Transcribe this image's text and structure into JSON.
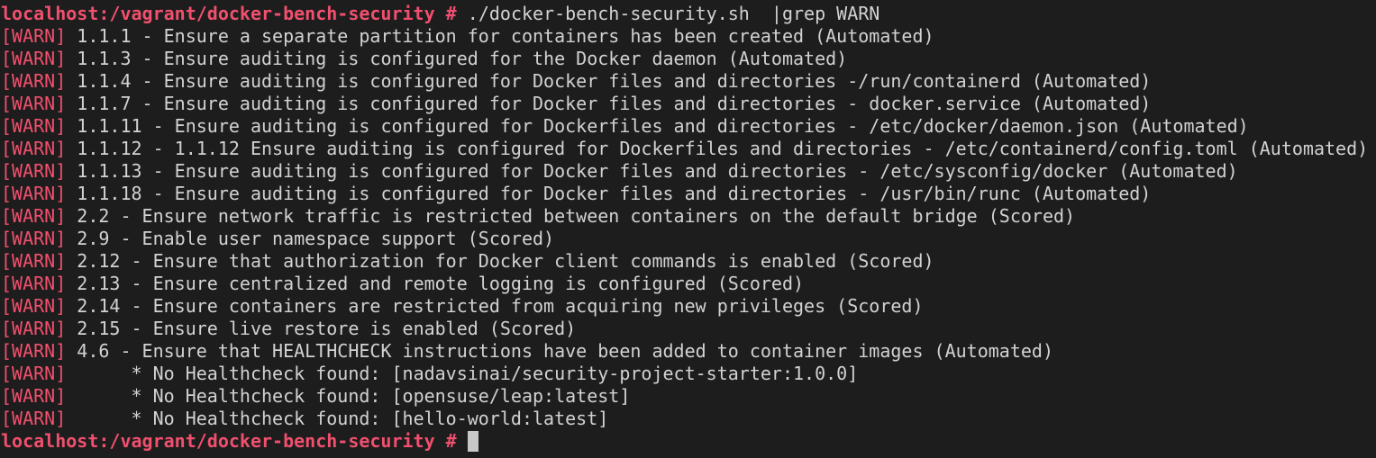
{
  "prompt": "localhost:/vagrant/docker-bench-security #",
  "command": " ./docker-bench-security.sh  |grep WARN",
  "tag": "[WARN]",
  "lines": [
    " 1.1.1 - Ensure a separate partition for containers has been created (Automated)",
    " 1.1.3 - Ensure auditing is configured for the Docker daemon (Automated)",
    " 1.1.4 - Ensure auditing is configured for Docker files and directories -/run/containerd (Automated)",
    " 1.1.7 - Ensure auditing is configured for Docker files and directories - docker.service (Automated)",
    " 1.1.11 - Ensure auditing is configured for Dockerfiles and directories - /etc/docker/daemon.json (Automated)",
    " 1.1.12 - 1.1.12 Ensure auditing is configured for Dockerfiles and directories - /etc/containerd/config.toml (Automated)",
    " 1.1.13 - Ensure auditing is configured for Docker files and directories - /etc/sysconfig/docker (Automated)",
    " 1.1.18 - Ensure auditing is configured for Docker files and directories - /usr/bin/runc (Automated)",
    " 2.2 - Ensure network traffic is restricted between containers on the default bridge (Scored)",
    " 2.9 - Enable user namespace support (Scored)",
    " 2.12 - Ensure that authorization for Docker client commands is enabled (Scored)",
    " 2.13 - Ensure centralized and remote logging is configured (Scored)",
    " 2.14 - Ensure containers are restricted from acquiring new privileges (Scored)",
    " 2.15 - Ensure live restore is enabled (Scored)",
    " 4.6 - Ensure that HEALTHCHECK instructions have been added to container images (Automated)",
    "      * No Healthcheck found: [nadavsinai/security-project-starter:1.0.0]",
    "      * No Healthcheck found: [opensuse/leap:latest]",
    "      * No Healthcheck found: [hello-world:latest]"
  ],
  "colors": {
    "background": "#1d1d1d",
    "accent": "#f0506e",
    "text": "#d2d2d2"
  }
}
